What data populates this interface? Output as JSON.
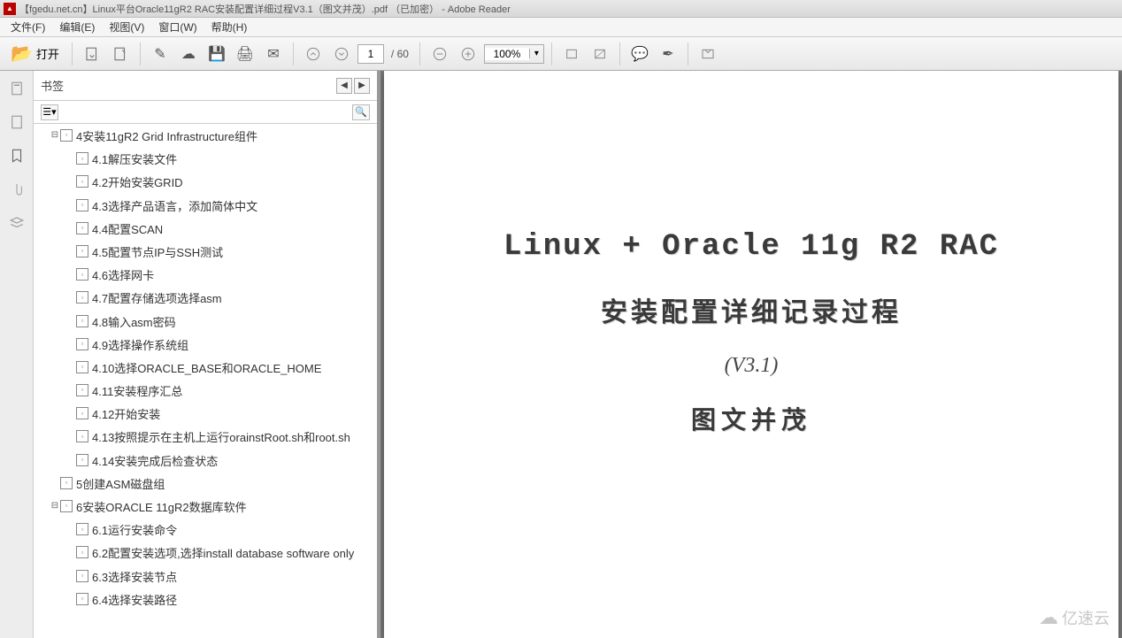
{
  "window": {
    "title": "【fgedu.net.cn】Linux平台Oracle11gR2 RAC安装配置详细过程V3.1（图文并茂）.pdf （已加密） - Adobe Reader"
  },
  "menu": {
    "file": "文件(F)",
    "edit": "编辑(E)",
    "view": "视图(V)",
    "window": "窗口(W)",
    "help": "帮助(H)"
  },
  "toolbar": {
    "open": "打开",
    "page_current": "1",
    "page_total": "/ 60",
    "zoom": "100%"
  },
  "bookmarks": {
    "title": "书签",
    "tree": [
      {
        "level": 1,
        "toggle": "⊟",
        "label": "4安装11gR2 Grid Infrastructure组件"
      },
      {
        "level": 2,
        "label": "4.1解压安装文件"
      },
      {
        "level": 2,
        "label": "4.2开始安装GRID"
      },
      {
        "level": 2,
        "label": "4.3选择产品语言，添加简体中文"
      },
      {
        "level": 2,
        "label": "4.4配置SCAN"
      },
      {
        "level": 2,
        "label": "4.5配置节点IP与SSH测试"
      },
      {
        "level": 2,
        "label": "4.6选择网卡"
      },
      {
        "level": 2,
        "label": "4.7配置存储选项选择asm"
      },
      {
        "level": 2,
        "label": "4.8输入asm密码"
      },
      {
        "level": 2,
        "label": "4.9选择操作系统组"
      },
      {
        "level": 2,
        "label": "4.10选择ORACLE_BASE和ORACLE_HOME"
      },
      {
        "level": 2,
        "label": "4.11安装程序汇总"
      },
      {
        "level": 2,
        "label": "4.12开始安装"
      },
      {
        "level": 2,
        "label": "4.13按照提示在主机上运行orainstRoot.sh和root.sh"
      },
      {
        "level": 2,
        "label": "4.14安装完成后检查状态"
      },
      {
        "level": 1,
        "label": "5创建ASM磁盘组"
      },
      {
        "level": 1,
        "toggle": "⊟",
        "label": "6安装ORACLE 11gR2数据库软件"
      },
      {
        "level": 2,
        "label": "6.1运行安装命令"
      },
      {
        "level": 2,
        "label": "6.2配置安装选项,选择install database software only"
      },
      {
        "level": 2,
        "label": "6.3选择安装节点"
      },
      {
        "level": 2,
        "label": "6.4选择安装路径"
      }
    ]
  },
  "document": {
    "title": "Linux + Oracle 11g R2 RAC",
    "subtitle": "安装配置详细记录过程",
    "version": "(V3.1)",
    "note": "图文并茂"
  },
  "watermark": "亿速云"
}
